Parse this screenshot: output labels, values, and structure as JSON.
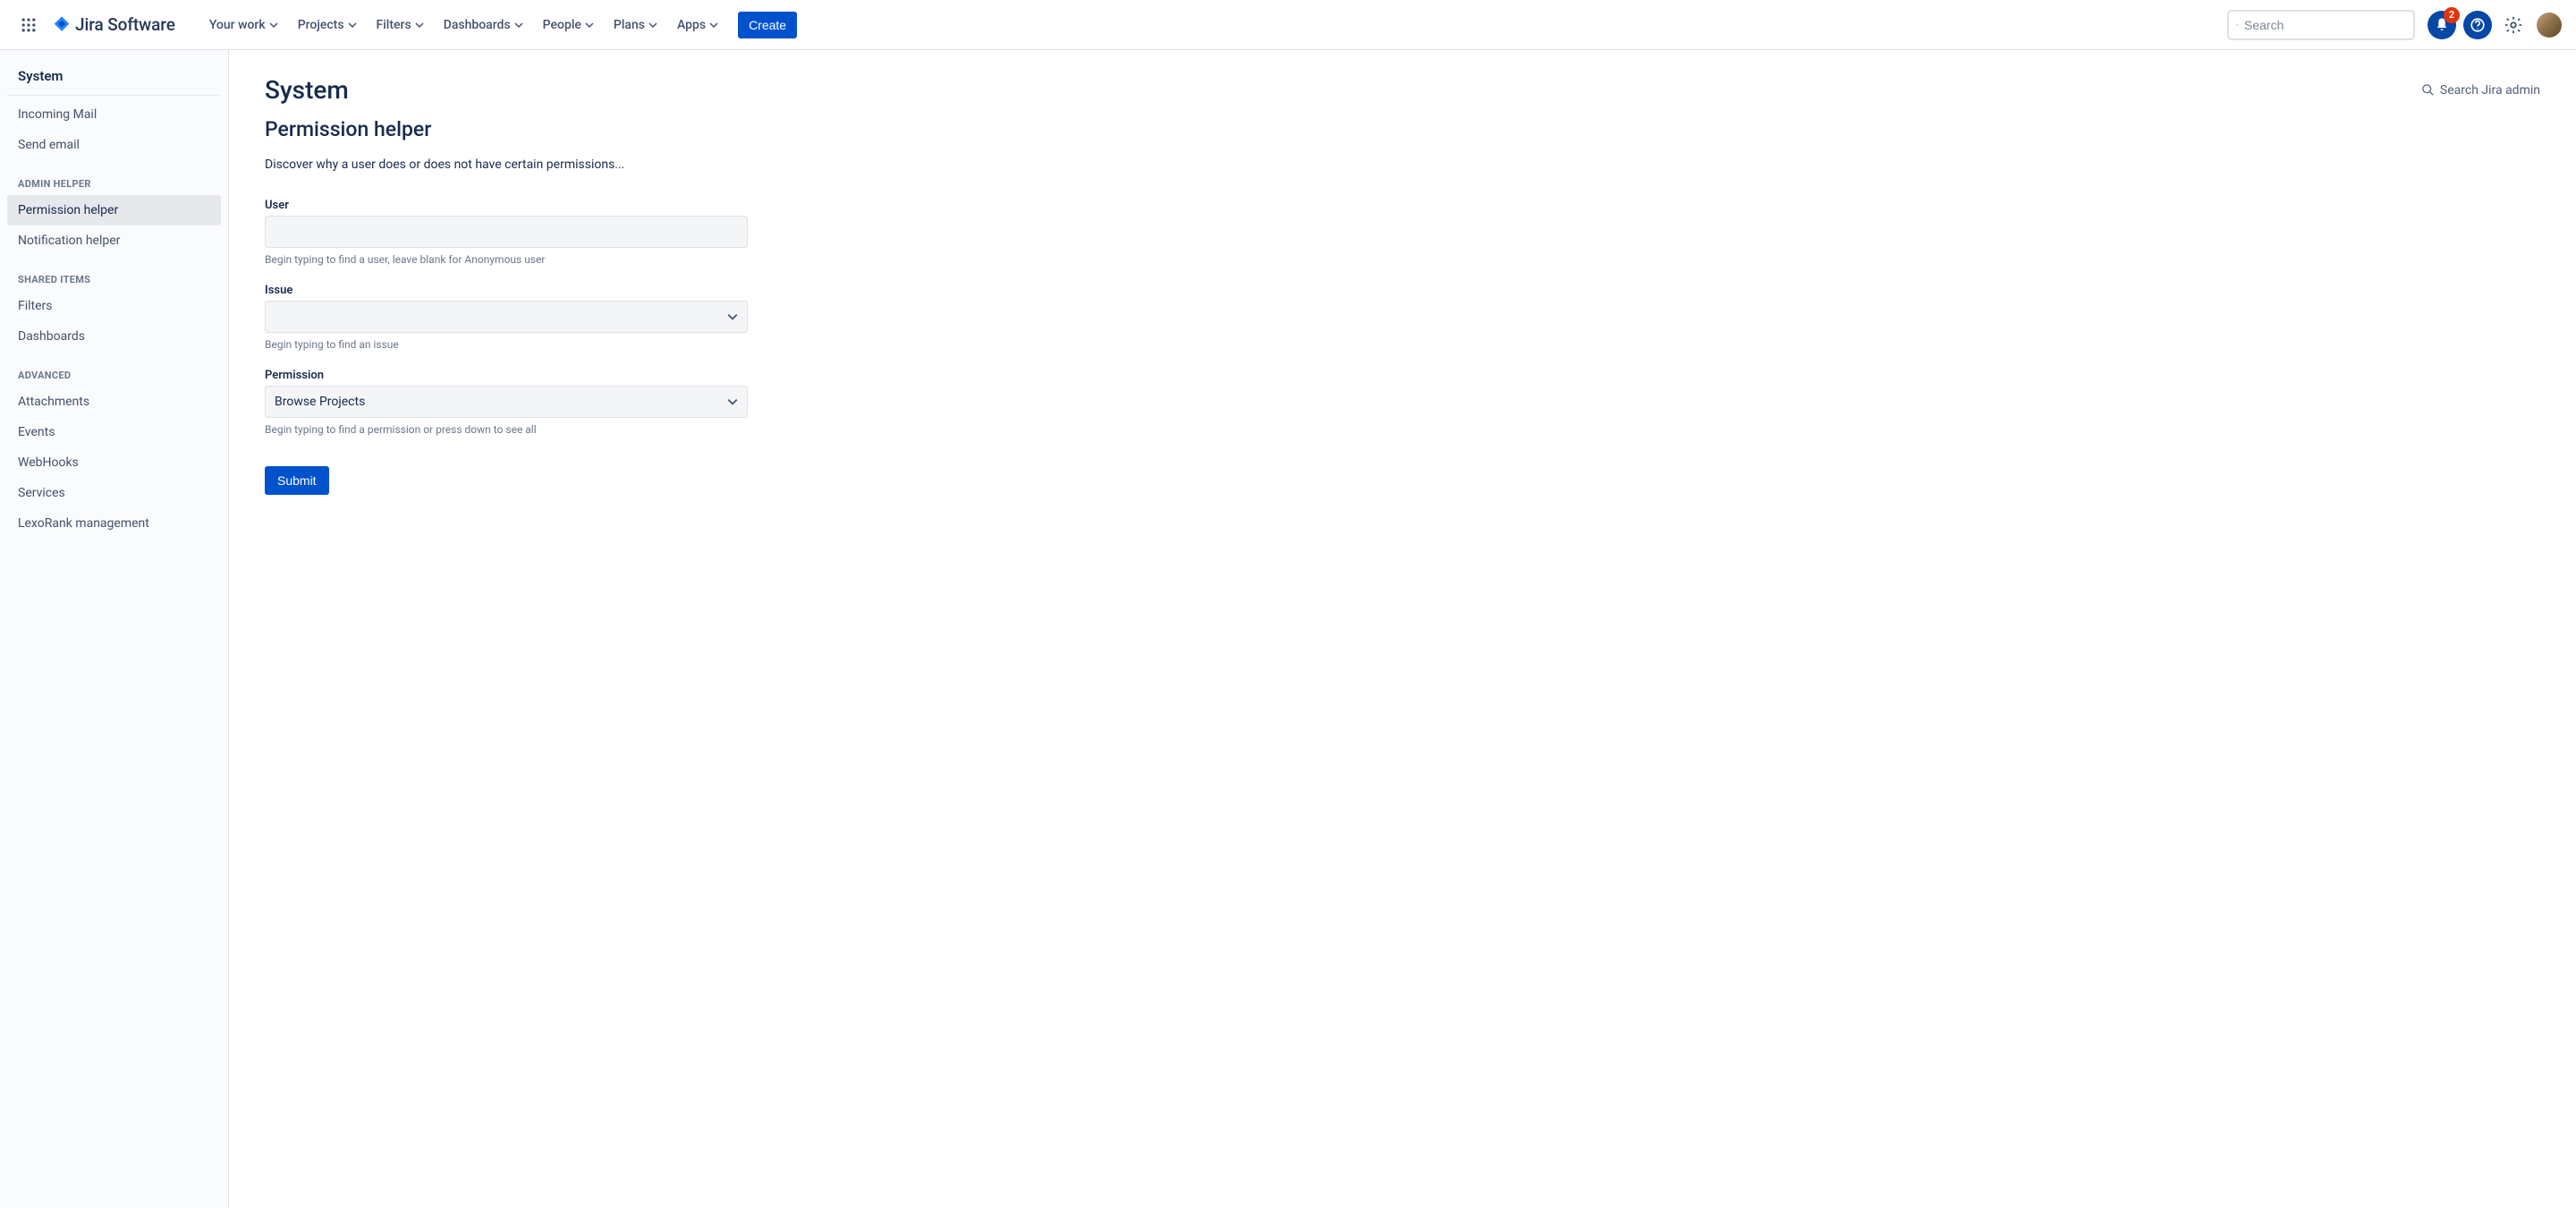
{
  "header": {
    "product_name": "Jira Software",
    "nav": [
      "Your work",
      "Projects",
      "Filters",
      "Dashboards",
      "People",
      "Plans",
      "Apps"
    ],
    "create_label": "Create",
    "search_placeholder": "Search",
    "notification_count": "2"
  },
  "sidebar": {
    "title": "System",
    "top_items": [
      "Incoming Mail",
      "Send email"
    ],
    "groups": [
      {
        "label": "ADMIN HELPER",
        "items": [
          "Permission helper",
          "Notification helper"
        ],
        "active_index": 0
      },
      {
        "label": "SHARED ITEMS",
        "items": [
          "Filters",
          "Dashboards"
        ]
      },
      {
        "label": "ADVANCED",
        "items": [
          "Attachments",
          "Events",
          "WebHooks",
          "Services",
          "LexoRank management"
        ]
      }
    ]
  },
  "main": {
    "page_title": "System",
    "search_admin_label": "Search Jira admin",
    "section_title": "Permission helper",
    "description": "Discover why a user does or does not have certain permissions...",
    "form": {
      "user": {
        "label": "User",
        "value": "",
        "help": "Begin typing to find a user, leave blank for Anonymous user"
      },
      "issue": {
        "label": "Issue",
        "value": "",
        "help": "Begin typing to find an issue"
      },
      "permission": {
        "label": "Permission",
        "value": "Browse Projects",
        "help": "Begin typing to find a permission or press down to see all"
      },
      "submit_label": "Submit"
    }
  }
}
